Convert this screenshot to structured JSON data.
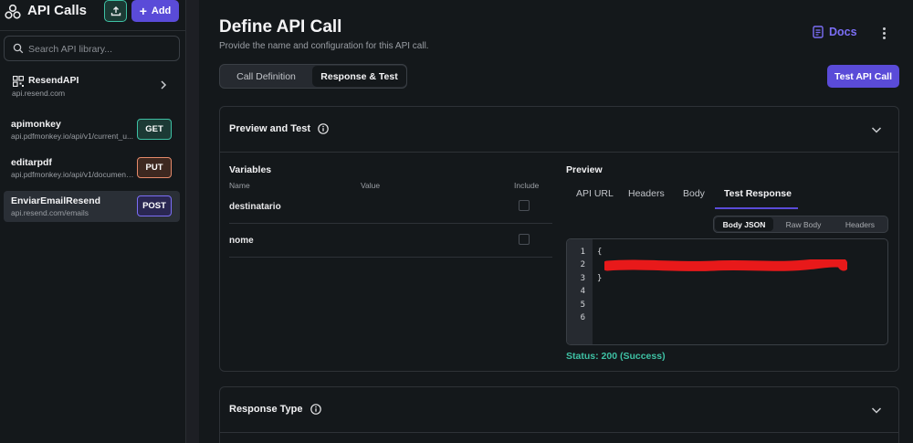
{
  "sidebar": {
    "title": "API Calls",
    "add_label": "Add",
    "search_placeholder": "Search API library...",
    "group": {
      "name": "ResendAPI",
      "url": "api.resend.com"
    },
    "items": [
      {
        "name": "apimonkey",
        "url": "api.pdfmonkey.io/api/v1/current_u...",
        "method": "GET"
      },
      {
        "name": "editarpdf",
        "url": "api.pdfmonkey.io/api/v1/document...",
        "method": "PUT"
      },
      {
        "name": "EnviarEmailResend",
        "url": "api.resend.com/emails",
        "method": "POST"
      }
    ]
  },
  "header": {
    "title": "Define API Call",
    "subtitle": "Provide the name and configuration for this API call.",
    "docs_label": "Docs",
    "tabs": [
      "Call Definition",
      "Response & Test"
    ],
    "active_tab": "Response & Test",
    "test_button": "Test API Call"
  },
  "preview_card": {
    "title": "Preview and Test",
    "variables": {
      "title": "Variables",
      "columns": [
        "Name",
        "Value",
        "Include"
      ],
      "rows": [
        {
          "name": "destinatario",
          "include": false
        },
        {
          "name": "nome",
          "include": false
        }
      ]
    },
    "preview": {
      "title": "Preview",
      "tabs": [
        "API URL",
        "Headers",
        "Body",
        "Test Response"
      ],
      "active_tab": "Test Response",
      "segments": [
        "Body JSON",
        "Raw Body",
        "Headers"
      ],
      "active_segment": "Body JSON",
      "code": {
        "line_numbers": [
          "1",
          "2",
          "3",
          "4",
          "5",
          "6"
        ],
        "lines": [
          "{",
          "",
          "}",
          "",
          "",
          ""
        ]
      },
      "status_label": "Status:",
      "status_value": "200 (Success)"
    }
  },
  "response_card": {
    "title": "Response Type"
  },
  "colors": {
    "accent": "#5a4bd8",
    "success": "#3ec1a4",
    "get": "#3ec1a4",
    "put": "#e58a6a",
    "post": "#7b6ef5",
    "redaction": "#e8191a"
  }
}
